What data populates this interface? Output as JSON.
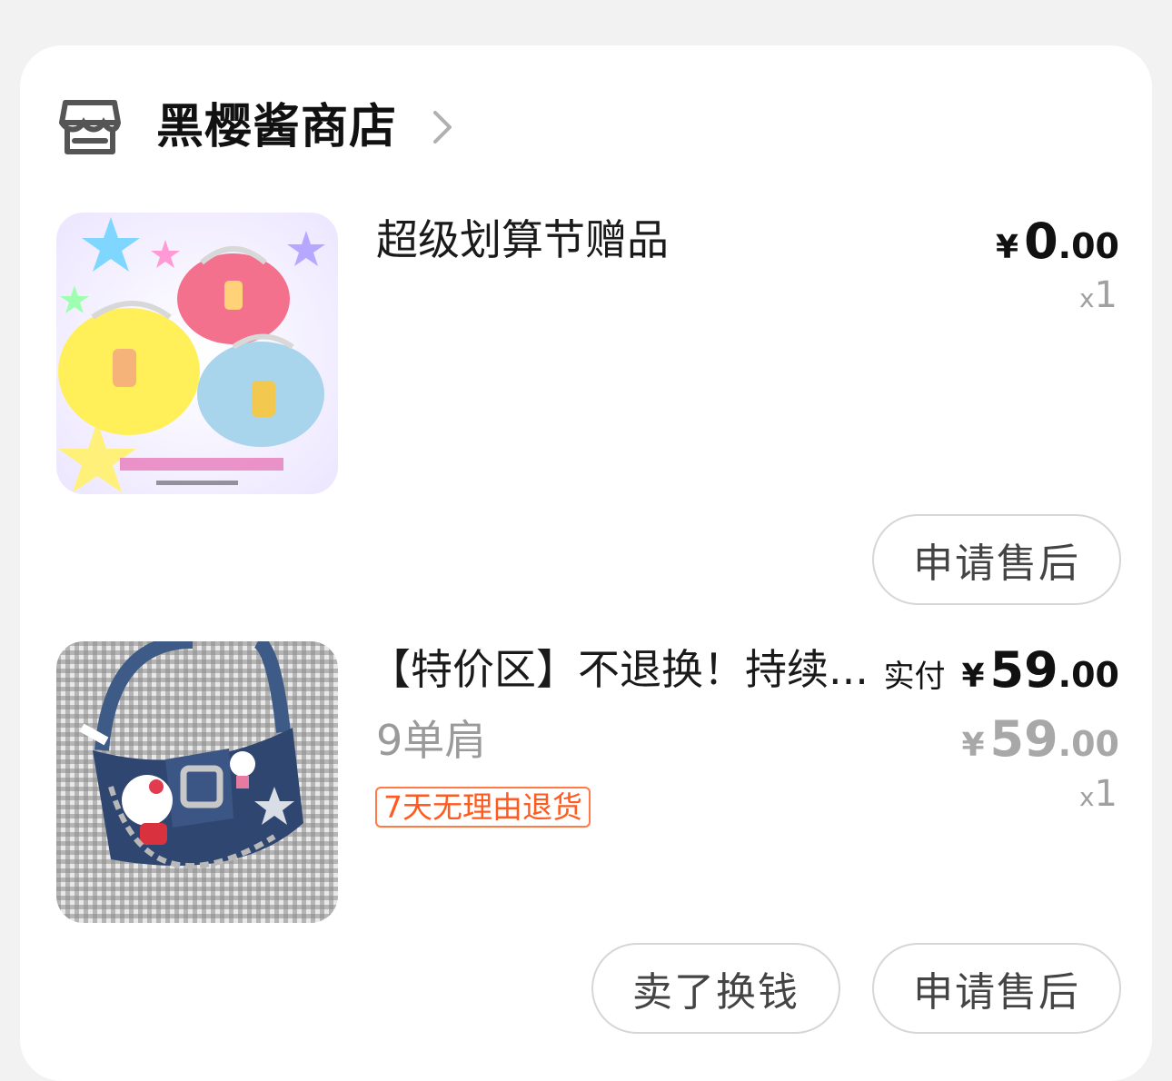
{
  "shop": {
    "name": "黑樱酱商店",
    "icon": "store-icon",
    "arrow_icon": "chevron-right-icon"
  },
  "items": [
    {
      "title": "超级划算节赠品",
      "price": {
        "currency": "¥",
        "int": "0",
        "dec": ".00"
      },
      "qty": {
        "x": "x",
        "n": "1"
      },
      "image": "fluffy-purses-image",
      "actions": [
        "申请售后"
      ]
    },
    {
      "title": "【特价区】不退换！持续...",
      "spec": "9单肩",
      "tag": "7天无理由退货",
      "paid_label": "实付",
      "price": {
        "currency": "¥",
        "int": "59",
        "dec": ".00"
      },
      "orig_price": {
        "currency": "¥",
        "int": "59",
        "dec": ".00"
      },
      "qty": {
        "x": "x",
        "n": "1"
      },
      "image": "denim-bag-image",
      "actions": [
        "卖了换钱",
        "申请售后"
      ]
    }
  ],
  "colors": {
    "tag": "#ff5a1f",
    "card": "#ffffff",
    "bg": "#f2f2f2"
  }
}
